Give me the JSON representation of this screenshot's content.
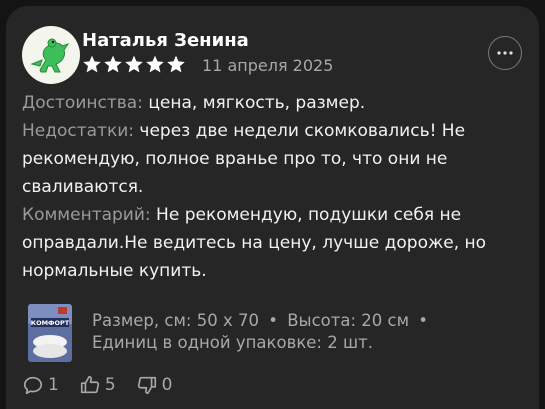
{
  "review": {
    "author": "Наталья Зенина",
    "rating": 5,
    "date": "11 апреля 2025",
    "pros_label": "Достоинства:",
    "pros_text": "цена, мягкость, размер.",
    "cons_label": "Недостатки:",
    "cons_text": "через две недели скомковались! Не рекомендую, полное вранье про то, что они не сваливаются.",
    "comment_label": "Комментарий:",
    "comment_text": "Не рекомендую, подушки себя не оправдали.Не  ведитесь на цену, лучше дороже, но нормальные купить.",
    "more_icon": "ellipsis-icon",
    "avatar_icon": "dinosaur-avatar"
  },
  "product": {
    "thumbnail_text": "КОМФОРТ",
    "size_label": "Размер, см:",
    "size_value": "50 x 70",
    "height_label": "Высота:",
    "height_value": "20 см",
    "units_label": "Единиц в одной упаковке:",
    "units_value": "2 шт.",
    "separator": "•"
  },
  "actions": {
    "comments_count": "1",
    "likes_count": "5",
    "dislikes_count": "0"
  },
  "colors": {
    "background": "#262626",
    "star": "#ffffff",
    "muted": "#a8a8a8"
  }
}
